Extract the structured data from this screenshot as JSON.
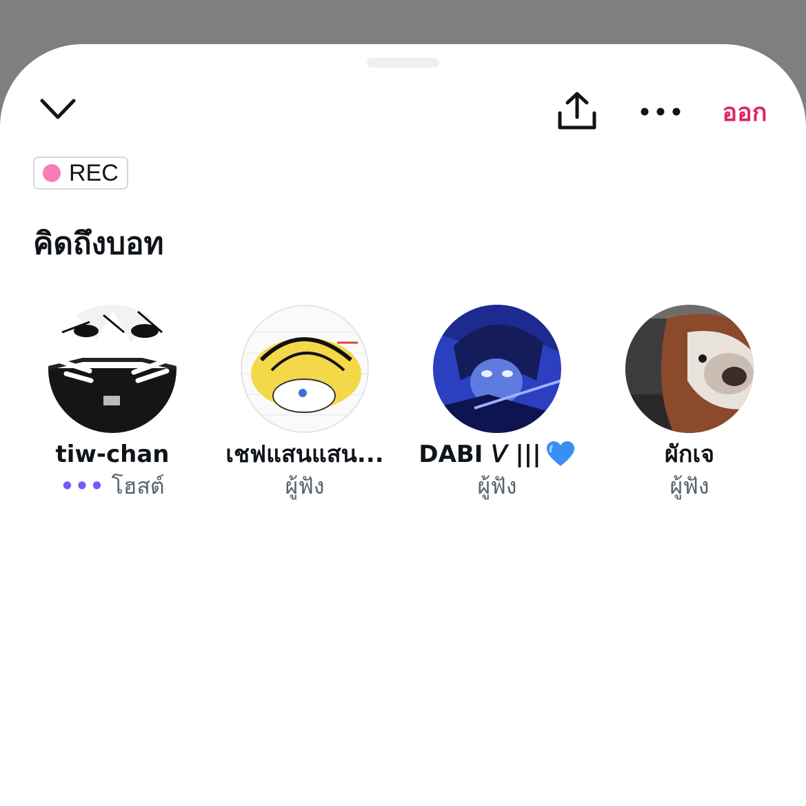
{
  "header": {
    "leave_label": "ออก",
    "accent_color": "#e0245e"
  },
  "icons": {
    "collapse": "chevron-down-icon",
    "share": "share-upload-icon",
    "more": "more-horizontal-icon"
  },
  "recording_badge": {
    "label": "REC",
    "dot_color": "#f67fb7"
  },
  "space": {
    "title": "คิดถึงบอท"
  },
  "participants": [
    {
      "name": "tiw-chan",
      "role": "โฮสต์",
      "speaking_indicator": "•••"
    },
    {
      "name": "เชฟแสนแสน...",
      "role": "ผู้ฟัง"
    },
    {
      "name": "DABI 𝘝 |||",
      "role": "ผู้ฟัง",
      "emoji": "blue-heart"
    },
    {
      "name": "ผักเจ",
      "role": "ผู้ฟัง"
    }
  ]
}
